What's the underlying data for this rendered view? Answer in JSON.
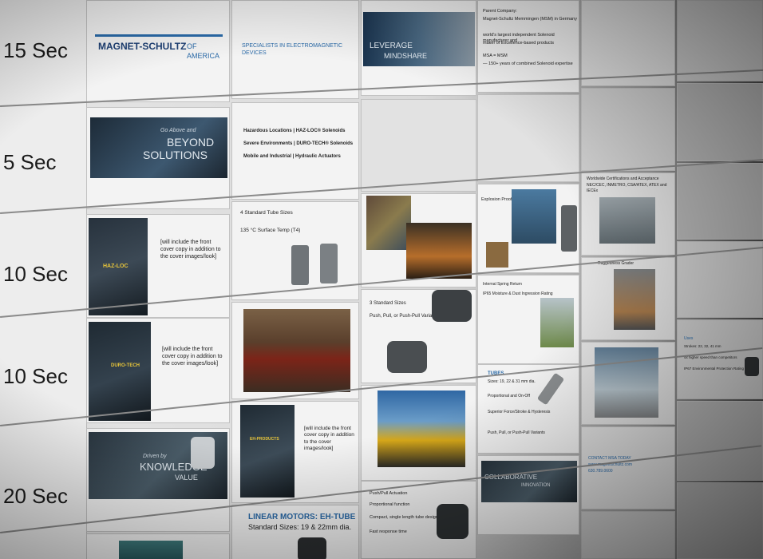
{
  "rows": [
    {
      "label": "15 Sec"
    },
    {
      "label": "5 Sec"
    },
    {
      "label": "10 Sec"
    },
    {
      "label": "10 Sec"
    },
    {
      "label": "20 Sec"
    }
  ],
  "tiles": {
    "logo": {
      "brand": "MAGNET-SCHULTZ",
      "suffix": "OF AMERICA"
    },
    "tagline": "SPECIALISTS IN ELECTROMAGNETIC DEVICES",
    "leverage": {
      "line1": "LEVERAGE",
      "line2": "MINDSHARE"
    },
    "parent": {
      "line1": "Parent Company:",
      "line2": "Magnet-Schultz Memmingen (MSM) in Germany",
      "line3": "world's largest independent Solenoid manufacturer and",
      "line4": "maker of Excellence-based products",
      "line5": "MSA = MSM",
      "line6": "— 150+ years of combined Solenoid expertise"
    },
    "beyond": {
      "script": "Go Above and",
      "line1": "BEYOND",
      "line2": "SOLUTIONS"
    },
    "product_lines": [
      "Hazardous Locations | HAZ-LOC® Solenoids",
      "Severe Environments | DURO-TECH® Solenoids",
      "Mobile and Industrial | Hydraulic Actuators"
    ],
    "hazloc_cover": {
      "title": "HAZ-LOC"
    },
    "cover_note": "[will include the front cover copy in addition to the cover images/look]",
    "tube_specs": {
      "line1": "4 Standard Tube Sizes",
      "line2": "135 °C Surface Temp (T4)"
    },
    "explosion": "Explosion Proof",
    "worldwide": {
      "line1": "Worldwide Certifications and Acceptance",
      "line2": "NEC/CEC, INMETRO, CSA/ATEX, ATEX and IECEx"
    },
    "durotech_cover": {
      "title": "DURO-TECH"
    },
    "standard_sizes": {
      "line1": "3 Standard Sizes",
      "line2": "Push, Pull, or Push-Pull Variants"
    },
    "spring_return": {
      "line1": "Internal Spring Return",
      "line2": "IP65 Moisture & Dust Ingression Rating"
    },
    "ruggedness": "Ruggedness Grader",
    "uses": {
      "line1": "Uses",
      "line2": "Strokes: 22, 32, 41 mm",
      "line3": "4x higher speed than competitors",
      "line4": "IP67 Environmental Protection Rating"
    },
    "ehproducts_cover": {
      "title": "EH-PRODUCTS"
    },
    "tubes": {
      "title": "TUBES",
      "line1": "Sizes: 19, 22 & 31 mm dia.",
      "line2": "Proportional and On-Off",
      "line3": "Superior Force/Stroke & Hysteresis",
      "line4": "Push, Pull, or Push-Pull Variants"
    },
    "knowledge": {
      "script": "Driven by",
      "line1": "KNOWLEDGE",
      "line2": "VALUE"
    },
    "pushpull": {
      "line1": "Push/Pull Actuation",
      "line2": "Proportional function",
      "line3": "Compact, single length tube design",
      "line4": "Fast response time"
    },
    "collab": {
      "line1": "COLLABORATIVE",
      "line2": "INNOVATION"
    },
    "contact": {
      "line1": "CONTACT MSA TODAY",
      "line2": "www.magnetschultz.com",
      "line3": "630.789.0600"
    },
    "linear": {
      "title": "LINEAR MOTORS: EH-TUBE",
      "line1": "Standard Sizes: 19 & 22mm dia."
    }
  },
  "colors": {
    "accent_blue": "#2a6aa8",
    "label_bg": "#ededed",
    "tile_bg": "#f3f3f3"
  }
}
